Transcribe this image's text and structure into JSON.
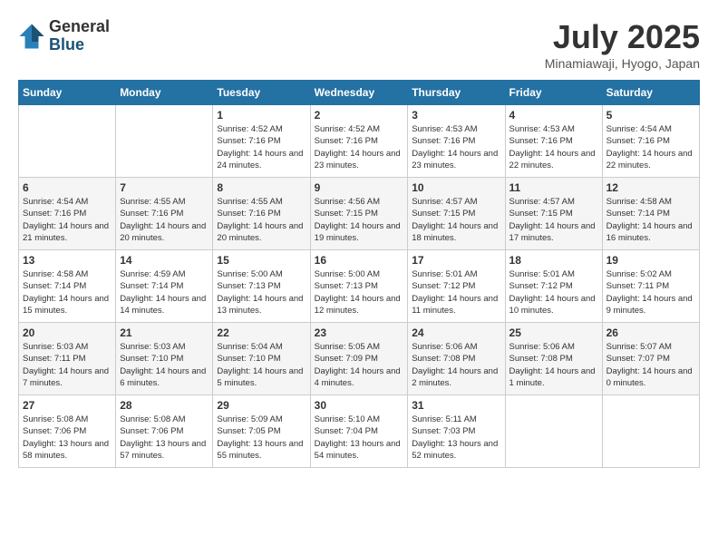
{
  "header": {
    "logo_general": "General",
    "logo_blue": "Blue",
    "month": "July 2025",
    "location": "Minamiawaji, Hyogo, Japan"
  },
  "days_of_week": [
    "Sunday",
    "Monday",
    "Tuesday",
    "Wednesday",
    "Thursday",
    "Friday",
    "Saturday"
  ],
  "weeks": [
    [
      {
        "day": "",
        "info": ""
      },
      {
        "day": "",
        "info": ""
      },
      {
        "day": "1",
        "info": "Sunrise: 4:52 AM\nSunset: 7:16 PM\nDaylight: 14 hours and 24 minutes."
      },
      {
        "day": "2",
        "info": "Sunrise: 4:52 AM\nSunset: 7:16 PM\nDaylight: 14 hours and 23 minutes."
      },
      {
        "day": "3",
        "info": "Sunrise: 4:53 AM\nSunset: 7:16 PM\nDaylight: 14 hours and 23 minutes."
      },
      {
        "day": "4",
        "info": "Sunrise: 4:53 AM\nSunset: 7:16 PM\nDaylight: 14 hours and 22 minutes."
      },
      {
        "day": "5",
        "info": "Sunrise: 4:54 AM\nSunset: 7:16 PM\nDaylight: 14 hours and 22 minutes."
      }
    ],
    [
      {
        "day": "6",
        "info": "Sunrise: 4:54 AM\nSunset: 7:16 PM\nDaylight: 14 hours and 21 minutes."
      },
      {
        "day": "7",
        "info": "Sunrise: 4:55 AM\nSunset: 7:16 PM\nDaylight: 14 hours and 20 minutes."
      },
      {
        "day": "8",
        "info": "Sunrise: 4:55 AM\nSunset: 7:16 PM\nDaylight: 14 hours and 20 minutes."
      },
      {
        "day": "9",
        "info": "Sunrise: 4:56 AM\nSunset: 7:15 PM\nDaylight: 14 hours and 19 minutes."
      },
      {
        "day": "10",
        "info": "Sunrise: 4:57 AM\nSunset: 7:15 PM\nDaylight: 14 hours and 18 minutes."
      },
      {
        "day": "11",
        "info": "Sunrise: 4:57 AM\nSunset: 7:15 PM\nDaylight: 14 hours and 17 minutes."
      },
      {
        "day": "12",
        "info": "Sunrise: 4:58 AM\nSunset: 7:14 PM\nDaylight: 14 hours and 16 minutes."
      }
    ],
    [
      {
        "day": "13",
        "info": "Sunrise: 4:58 AM\nSunset: 7:14 PM\nDaylight: 14 hours and 15 minutes."
      },
      {
        "day": "14",
        "info": "Sunrise: 4:59 AM\nSunset: 7:14 PM\nDaylight: 14 hours and 14 minutes."
      },
      {
        "day": "15",
        "info": "Sunrise: 5:00 AM\nSunset: 7:13 PM\nDaylight: 14 hours and 13 minutes."
      },
      {
        "day": "16",
        "info": "Sunrise: 5:00 AM\nSunset: 7:13 PM\nDaylight: 14 hours and 12 minutes."
      },
      {
        "day": "17",
        "info": "Sunrise: 5:01 AM\nSunset: 7:12 PM\nDaylight: 14 hours and 11 minutes."
      },
      {
        "day": "18",
        "info": "Sunrise: 5:01 AM\nSunset: 7:12 PM\nDaylight: 14 hours and 10 minutes."
      },
      {
        "day": "19",
        "info": "Sunrise: 5:02 AM\nSunset: 7:11 PM\nDaylight: 14 hours and 9 minutes."
      }
    ],
    [
      {
        "day": "20",
        "info": "Sunrise: 5:03 AM\nSunset: 7:11 PM\nDaylight: 14 hours and 7 minutes."
      },
      {
        "day": "21",
        "info": "Sunrise: 5:03 AM\nSunset: 7:10 PM\nDaylight: 14 hours and 6 minutes."
      },
      {
        "day": "22",
        "info": "Sunrise: 5:04 AM\nSunset: 7:10 PM\nDaylight: 14 hours and 5 minutes."
      },
      {
        "day": "23",
        "info": "Sunrise: 5:05 AM\nSunset: 7:09 PM\nDaylight: 14 hours and 4 minutes."
      },
      {
        "day": "24",
        "info": "Sunrise: 5:06 AM\nSunset: 7:08 PM\nDaylight: 14 hours and 2 minutes."
      },
      {
        "day": "25",
        "info": "Sunrise: 5:06 AM\nSunset: 7:08 PM\nDaylight: 14 hours and 1 minute."
      },
      {
        "day": "26",
        "info": "Sunrise: 5:07 AM\nSunset: 7:07 PM\nDaylight: 14 hours and 0 minutes."
      }
    ],
    [
      {
        "day": "27",
        "info": "Sunrise: 5:08 AM\nSunset: 7:06 PM\nDaylight: 13 hours and 58 minutes."
      },
      {
        "day": "28",
        "info": "Sunrise: 5:08 AM\nSunset: 7:06 PM\nDaylight: 13 hours and 57 minutes."
      },
      {
        "day": "29",
        "info": "Sunrise: 5:09 AM\nSunset: 7:05 PM\nDaylight: 13 hours and 55 minutes."
      },
      {
        "day": "30",
        "info": "Sunrise: 5:10 AM\nSunset: 7:04 PM\nDaylight: 13 hours and 54 minutes."
      },
      {
        "day": "31",
        "info": "Sunrise: 5:11 AM\nSunset: 7:03 PM\nDaylight: 13 hours and 52 minutes."
      },
      {
        "day": "",
        "info": ""
      },
      {
        "day": "",
        "info": ""
      }
    ]
  ]
}
